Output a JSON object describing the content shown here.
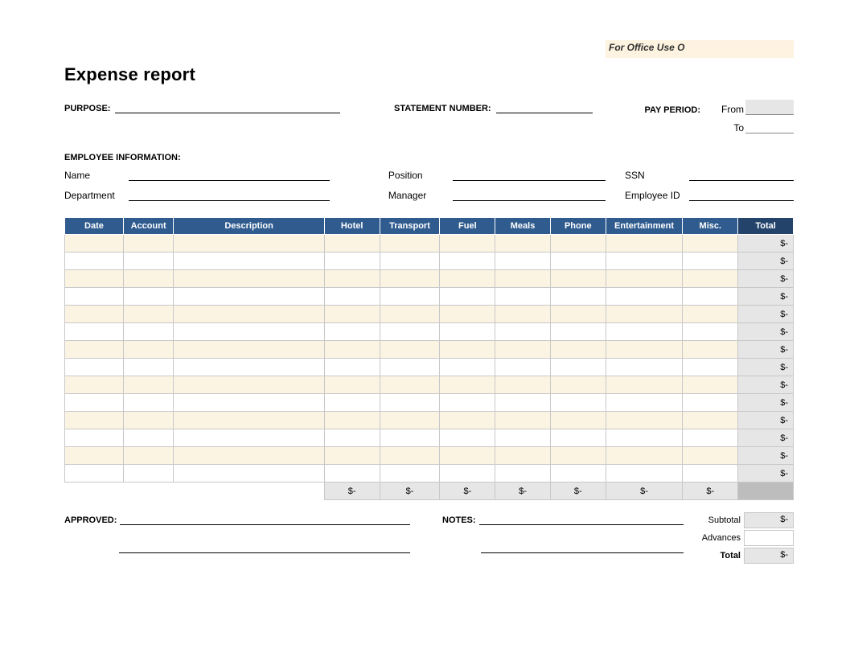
{
  "office_use": "For Office Use O",
  "title": "Expense report",
  "fields": {
    "purpose_label": "PURPOSE:",
    "statement_label": "STATEMENT NUMBER:",
    "pay_period_label": "PAY PERIOD:",
    "pay_from_label": "From",
    "pay_to_label": "To",
    "pay_from_value": "",
    "pay_to_value": ""
  },
  "employee": {
    "section_label": "EMPLOYEE INFORMATION:",
    "name_label": "Name",
    "department_label": "Department",
    "position_label": "Position",
    "manager_label": "Manager",
    "ssn_label": "SSN",
    "employee_id_label": "Employee ID"
  },
  "table": {
    "headers": {
      "date": "Date",
      "account": "Account",
      "description": "Description",
      "hotel": "Hotel",
      "transport": "Transport",
      "fuel": "Fuel",
      "meals": "Meals",
      "phone": "Phone",
      "entertainment": "Entertainment",
      "misc": "Misc.",
      "total": "Total"
    },
    "row_total_value": "$-",
    "column_total_value": "$-",
    "num_rows": 14
  },
  "footer": {
    "approved_label": "APPROVED:",
    "notes_label": "NOTES:",
    "subtotal_label": "Subtotal",
    "subtotal_value": "$-",
    "advances_label": "Advances",
    "advances_value": "",
    "total_label": "Total",
    "total_value": "$-"
  },
  "chart_data": {
    "type": "table",
    "title": "Expense report",
    "columns": [
      "Date",
      "Account",
      "Description",
      "Hotel",
      "Transport",
      "Fuel",
      "Meals",
      "Phone",
      "Entertainment",
      "Misc.",
      "Total"
    ],
    "rows": [
      [
        "",
        "",
        "",
        "",
        "",
        "",
        "",
        "",
        "",
        "",
        "$-"
      ],
      [
        "",
        "",
        "",
        "",
        "",
        "",
        "",
        "",
        "",
        "",
        "$-"
      ],
      [
        "",
        "",
        "",
        "",
        "",
        "",
        "",
        "",
        "",
        "",
        "$-"
      ],
      [
        "",
        "",
        "",
        "",
        "",
        "",
        "",
        "",
        "",
        "",
        "$-"
      ],
      [
        "",
        "",
        "",
        "",
        "",
        "",
        "",
        "",
        "",
        "",
        "$-"
      ],
      [
        "",
        "",
        "",
        "",
        "",
        "",
        "",
        "",
        "",
        "",
        "$-"
      ],
      [
        "",
        "",
        "",
        "",
        "",
        "",
        "",
        "",
        "",
        "",
        "$-"
      ],
      [
        "",
        "",
        "",
        "",
        "",
        "",
        "",
        "",
        "",
        "",
        "$-"
      ],
      [
        "",
        "",
        "",
        "",
        "",
        "",
        "",
        "",
        "",
        "",
        "$-"
      ],
      [
        "",
        "",
        "",
        "",
        "",
        "",
        "",
        "",
        "",
        "",
        "$-"
      ],
      [
        "",
        "",
        "",
        "",
        "",
        "",
        "",
        "",
        "",
        "",
        "$-"
      ],
      [
        "",
        "",
        "",
        "",
        "",
        "",
        "",
        "",
        "",
        "",
        "$-"
      ],
      [
        "",
        "",
        "",
        "",
        "",
        "",
        "",
        "",
        "",
        "",
        "$-"
      ],
      [
        "",
        "",
        "",
        "",
        "",
        "",
        "",
        "",
        "",
        "",
        "$-"
      ]
    ],
    "column_totals": [
      "",
      "",
      "",
      "$-",
      "$-",
      "$-",
      "$-",
      "$-",
      "$-",
      "$-",
      ""
    ],
    "summary": {
      "Subtotal": "$-",
      "Advances": "",
      "Total": "$-"
    }
  }
}
